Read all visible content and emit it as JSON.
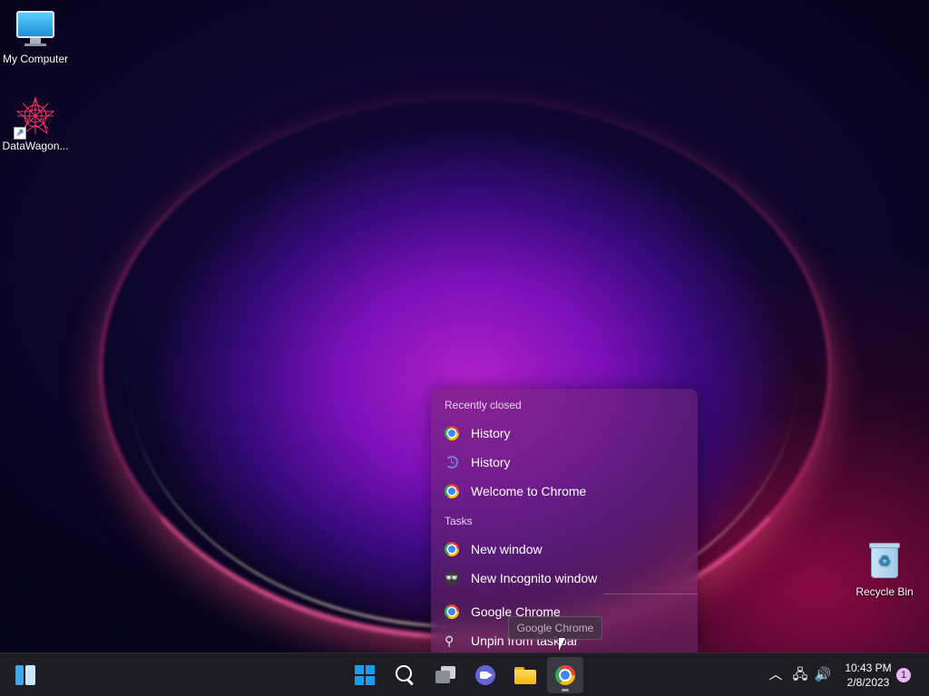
{
  "desktop": {
    "icons": [
      {
        "label": "My Computer"
      },
      {
        "label": "DataWagon..."
      },
      {
        "label": "Recycle Bin"
      }
    ]
  },
  "jumplist": {
    "recently_closed_header": "Recently closed",
    "recently_closed": [
      {
        "label": "History",
        "icon": "chrome-icon"
      },
      {
        "label": "History",
        "icon": "history-icon"
      },
      {
        "label": "Welcome to Chrome",
        "icon": "chrome-icon"
      }
    ],
    "tasks_header": "Tasks",
    "tasks": [
      {
        "label": "New window",
        "icon": "chrome-icon"
      },
      {
        "label": "New Incognito window",
        "icon": "incognito-icon"
      }
    ],
    "app": {
      "label": "Google Chrome",
      "icon": "chrome-icon"
    },
    "unpin": {
      "label": "Unpin from taskbar",
      "icon": "unpin-icon"
    }
  },
  "tooltip": {
    "text": "Google Chrome"
  },
  "taskbar": {
    "apps": [
      "widgets-icon",
      "start-icon",
      "search-icon",
      "task-view-icon",
      "meet-icon",
      "file-explorer-icon",
      "chrome-icon"
    ],
    "tray": {
      "time": "10:43 PM",
      "date": "2/8/2023",
      "notification_count": "1"
    }
  },
  "colors": {
    "taskbar_bg": "#1e1d24",
    "windows_blue": "#1a9ce8",
    "jumplist_bg": "#6e286e"
  }
}
